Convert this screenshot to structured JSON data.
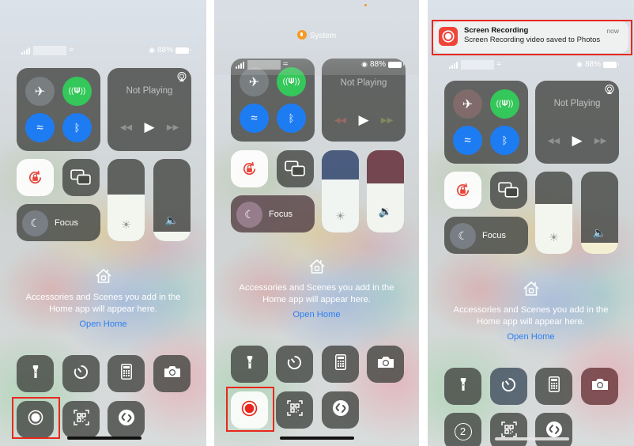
{
  "colors": {
    "highlight": "#e8281e",
    "link": "#2f7ff0",
    "green": "#34c759",
    "blue": "#1e7cf2",
    "record_red": "#f04438",
    "mic_orange": "#f59a23"
  },
  "status_bar": {
    "battery_percent": "88%",
    "icons": [
      "cellular-signal-icon",
      "wifi-icon",
      "orientation-lock-icon",
      "battery-icon"
    ]
  },
  "connectivity": {
    "items": [
      {
        "name": "airplane-mode",
        "icon": "airplane-icon",
        "state": "off"
      },
      {
        "name": "cellular-data",
        "icon": "antenna-icon",
        "state": "on"
      },
      {
        "name": "wifi",
        "icon": "wifi-icon",
        "state": "on"
      },
      {
        "name": "bluetooth",
        "icon": "bluetooth-icon",
        "state": "on"
      }
    ]
  },
  "now_playing": {
    "title": "Not Playing",
    "controls": [
      "rewind-icon",
      "play-icon",
      "fast-forward-icon"
    ]
  },
  "focus": {
    "label": "Focus"
  },
  "sliders": {
    "panel1": {
      "brightness": 0.57,
      "volume": 0.12
    },
    "panel2": {
      "brightness": 0.64,
      "volume": 0.6
    },
    "panel3": {
      "brightness": 0.61,
      "volume": 0.13
    }
  },
  "home": {
    "message_line1": "Accessories and Scenes you add in the",
    "message_line2": "Home app will appear here.",
    "link": "Open Home"
  },
  "panel2": {
    "mic_indicator_label": "System"
  },
  "panel3": {
    "notification": {
      "app": "Screen Recording",
      "message": "Screen Recording video saved to Photos",
      "time": "now"
    },
    "countdown": "2"
  },
  "bottom_buttons": [
    "flashlight-icon",
    "timer-icon",
    "calculator-icon",
    "camera-icon",
    "screen-record-icon",
    "qr-scanner-icon",
    "shazam-icon"
  ]
}
